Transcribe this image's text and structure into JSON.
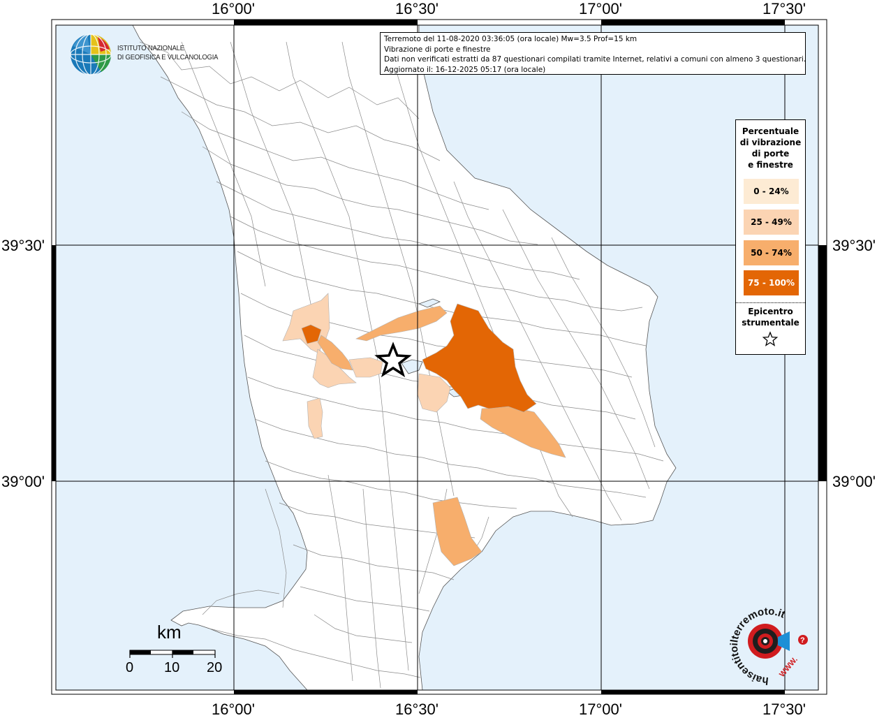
{
  "header": {
    "info_lines": [
      "Terremoto del 11-08-2020 03:36:05 (ora locale) Mw=3.5 Prof=15 km",
      "Vibrazione di porte e finestre",
      "Dati non verificati estratti da 87 questionari compilati tramite Internet, relativi a comuni con almeno 3 questionari.",
      "Aggiornato il: 16-12-2025 05:17 (ora locale)"
    ]
  },
  "axes": {
    "lon_labels": [
      "16°00'",
      "16°30'",
      "17°00'",
      "17°30'"
    ],
    "lat_labels": [
      "39°30'",
      "39°00'"
    ]
  },
  "logo_ingv": {
    "line1": "ISTITUTO NAZIONALE",
    "line2": "DI GEOFISICA E VULCANOLOGIA"
  },
  "legend": {
    "title_lines": [
      "Percentuale",
      "di vibrazione",
      "di porte",
      "e finestre"
    ],
    "classes": [
      {
        "label": "0 - 24%",
        "color": "#fdebd4",
        "text_color": "#000000"
      },
      {
        "label": "25 - 49%",
        "color": "#fbd4b3",
        "text_color": "#000000"
      },
      {
        "label": "50 - 74%",
        "color": "#f7ae6c",
        "text_color": "#000000"
      },
      {
        "label": "75 - 100%",
        "color": "#e36605",
        "text_color": "#ffffff"
      }
    ],
    "epicenter_lines": [
      "Epicentro",
      "strumentale"
    ]
  },
  "scalebar": {
    "unit": "km",
    "ticks": [
      "0",
      "10",
      "20"
    ]
  },
  "logo_hst": {
    "ring_text": "haisentitoilterremoto.it",
    "www": "WWW.",
    "question": "?"
  },
  "colors": {
    "sea": "#e4f1fb",
    "land": "#ffffff",
    "border": "#7f7f7f"
  }
}
